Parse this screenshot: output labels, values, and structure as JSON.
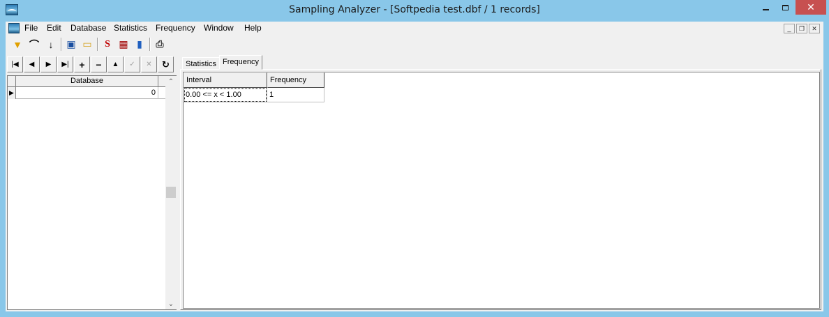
{
  "window": {
    "title": "Sampling Analyzer - [Softpedia test.dbf / 1 records]",
    "close_glyph": "✕",
    "accent_color": "#89c7e9",
    "close_color": "#c75050"
  },
  "menu": {
    "items": [
      "File",
      "Edit",
      "Database",
      "Statistics",
      "Frequency",
      "Window",
      "Help"
    ]
  },
  "mdi_controls": {
    "minimize": "_",
    "restore": "❐",
    "close": "✕"
  },
  "toolbar": {
    "buttons": [
      {
        "name": "filter-icon",
        "glyph": "▼"
      },
      {
        "name": "curve-icon",
        "glyph": "⌒"
      },
      {
        "name": "sort-az-icon",
        "glyph": "↓"
      },
      {
        "name": "save-disk-icon",
        "glyph": "▣"
      },
      {
        "name": "open-folder-icon",
        "glyph": "▭"
      },
      {
        "name": "statistics-icon",
        "glyph": "S"
      },
      {
        "name": "table-icon",
        "glyph": "▦"
      },
      {
        "name": "bar-chart-icon",
        "glyph": "▮"
      },
      {
        "name": "print-icon",
        "glyph": "⎙"
      }
    ]
  },
  "navigator": {
    "buttons": [
      {
        "name": "first-record-icon",
        "glyph": "|◀",
        "enabled": true
      },
      {
        "name": "prior-record-icon",
        "glyph": "◀",
        "enabled": true
      },
      {
        "name": "next-record-icon",
        "glyph": "▶",
        "enabled": true
      },
      {
        "name": "last-record-icon",
        "glyph": "▶|",
        "enabled": true
      },
      {
        "name": "insert-record-icon",
        "glyph": "+",
        "enabled": true
      },
      {
        "name": "delete-record-icon",
        "glyph": "−",
        "enabled": true
      },
      {
        "name": "edit-record-icon",
        "glyph": "▲",
        "enabled": true
      },
      {
        "name": "post-record-icon",
        "glyph": "✓",
        "enabled": false
      },
      {
        "name": "cancel-record-icon",
        "glyph": "✕",
        "enabled": false
      },
      {
        "name": "refresh-icon",
        "glyph": "↻",
        "enabled": true
      }
    ]
  },
  "database_grid": {
    "column_header": "Database",
    "rows": [
      {
        "indicator": "▶",
        "value": "0"
      }
    ],
    "scroll_up": "⌃",
    "scroll_down": "⌄"
  },
  "tabs": {
    "items": [
      {
        "label": "Statistics",
        "active": false
      },
      {
        "label": "Frequency",
        "active": true
      }
    ]
  },
  "frequency_table": {
    "headers": [
      "Interval",
      "Frequency"
    ],
    "rows": [
      [
        "0.00 <= x < 1.00",
        "1"
      ]
    ]
  }
}
